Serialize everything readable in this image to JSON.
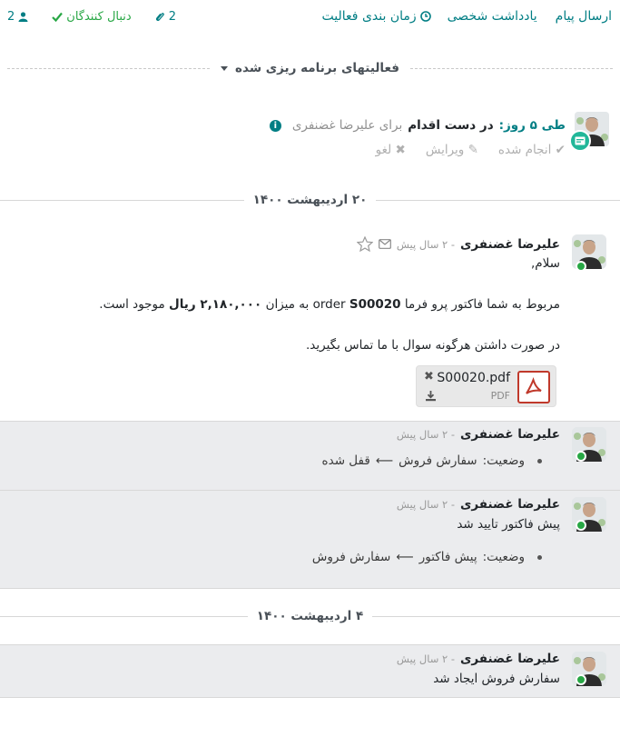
{
  "topbar": {
    "send_message": "ارسال پیام",
    "log_note": "یادداشت شخصی",
    "schedule_activity": "زمان بندی فعالیت",
    "attachments_count": "2",
    "follow_label": "دنبال کنندگان",
    "followers_count": "2",
    "colors": {
      "link": "#017e84",
      "follow": "#28a745"
    },
    "icons": {
      "schedule": "clock-icon",
      "attachments": "paperclip-icon",
      "follow": "check-icon",
      "followers": "user-icon"
    }
  },
  "planned": {
    "title": "فعالیتهای برنامه ریزی شده",
    "activity": {
      "due": "طی ۵ روز:",
      "summary": "در دست اقدام",
      "for_label": "برای علیرضا غضنفری",
      "done": "انجام شده",
      "edit": "ویرایش",
      "cancel": "لغو"
    }
  },
  "date_separators": [
    "۲۰ اردیبهشت ۱۴۰۰",
    "۴ اردیبهشت ۱۴۰۰"
  ],
  "messages": [
    {
      "author": "علیرضا غضنفری",
      "ago": "- ۲ سال پیش",
      "greeting": "سلام,",
      "body_pre": "مربوط به شما فاکتور پرو فرما",
      "order_ref": "S00020",
      "body_mid1": " order ",
      "body_mid2": " به میزان ",
      "amount": "۲,۱۸۰,۰۰۰ ریال",
      "body_post": " موجود است.",
      "contact": "در صورت داشتن هرگونه سوال با ما تماس بگیرید.",
      "attachment": {
        "name": "S00020.pdf",
        "type": "PDF"
      }
    },
    {
      "author": "علیرضا غضنفری",
      "ago": "- ۲ سال پیش",
      "tracking": {
        "field": "وضعیت:",
        "old": "سفارش فروش",
        "new": "قفل شده"
      }
    },
    {
      "author": "علیرضا غضنفری",
      "ago": "- ۲ سال پیش",
      "text": "پیش فاکتور تایید شد",
      "tracking": {
        "field": "وضعیت:",
        "old": "پیش فاکتور",
        "new": "سفارش فروش"
      }
    },
    {
      "author": "علیرضا غضنفری",
      "ago": "- ۲ سال پیش",
      "text": "سفارش فروش ایجاد شد"
    }
  ]
}
